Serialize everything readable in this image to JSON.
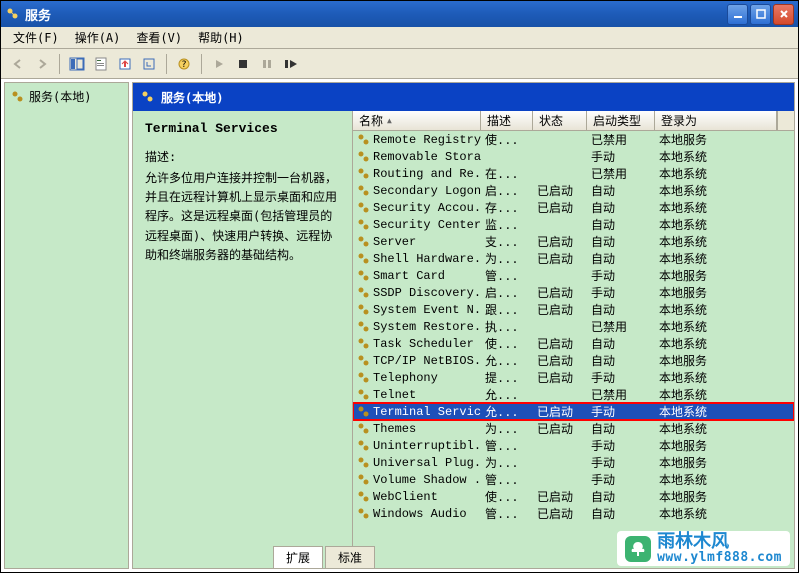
{
  "window": {
    "title": "服务"
  },
  "menu": {
    "file": "文件(F)",
    "action": "操作(A)",
    "view": "查看(V)",
    "help": "帮助(H)"
  },
  "tree": {
    "root": "服务(本地)"
  },
  "panel": {
    "header": "服务(本地)"
  },
  "detail": {
    "service_name": "Terminal Services",
    "desc_label": "描述:",
    "description": "允许多位用户连接并控制一台机器，并且在远程计算机上显示桌面和应用程序。这是远程桌面(包括管理员的远程桌面)、快速用户转换、远程协助和终端服务器的基础结构。"
  },
  "columns": {
    "name": "名称",
    "desc": "描述",
    "status": "状态",
    "startup": "启动类型",
    "logon": "登录为"
  },
  "tabs": {
    "extended": "扩展",
    "standard": "标准"
  },
  "watermark": {
    "brand": "雨林木风",
    "url": "www.ylmf888.com"
  },
  "services": [
    {
      "name": "Remote Registry",
      "desc": "使...",
      "status": "",
      "startup": "已禁用",
      "logon": "本地服务"
    },
    {
      "name": "Removable Storage",
      "desc": "",
      "status": "",
      "startup": "手动",
      "logon": "本地系统"
    },
    {
      "name": "Routing and Re...",
      "desc": "在...",
      "status": "",
      "startup": "已禁用",
      "logon": "本地系统"
    },
    {
      "name": "Secondary Logon",
      "desc": "启...",
      "status": "已启动",
      "startup": "自动",
      "logon": "本地系统"
    },
    {
      "name": "Security Accou...",
      "desc": "存...",
      "status": "已启动",
      "startup": "自动",
      "logon": "本地系统"
    },
    {
      "name": "Security Center",
      "desc": "监...",
      "status": "",
      "startup": "自动",
      "logon": "本地系统"
    },
    {
      "name": "Server",
      "desc": "支...",
      "status": "已启动",
      "startup": "自动",
      "logon": "本地系统"
    },
    {
      "name": "Shell Hardware...",
      "desc": "为...",
      "status": "已启动",
      "startup": "自动",
      "logon": "本地系统"
    },
    {
      "name": "Smart Card",
      "desc": "管...",
      "status": "",
      "startup": "手动",
      "logon": "本地服务"
    },
    {
      "name": "SSDP Discovery...",
      "desc": "启...",
      "status": "已启动",
      "startup": "手动",
      "logon": "本地服务"
    },
    {
      "name": "System Event N...",
      "desc": "跟...",
      "status": "已启动",
      "startup": "自动",
      "logon": "本地系统"
    },
    {
      "name": "System Restore...",
      "desc": "执...",
      "status": "",
      "startup": "已禁用",
      "logon": "本地系统"
    },
    {
      "name": "Task Scheduler",
      "desc": "使...",
      "status": "已启动",
      "startup": "自动",
      "logon": "本地系统"
    },
    {
      "name": "TCP/IP NetBIOS...",
      "desc": "允...",
      "status": "已启动",
      "startup": "自动",
      "logon": "本地服务"
    },
    {
      "name": "Telephony",
      "desc": "提...",
      "status": "已启动",
      "startup": "手动",
      "logon": "本地系统"
    },
    {
      "name": "Telnet",
      "desc": "允...",
      "status": "",
      "startup": "已禁用",
      "logon": "本地系统"
    },
    {
      "name": "Terminal Services",
      "desc": "允...",
      "status": "已启动",
      "startup": "手动",
      "logon": "本地系统",
      "selected": true,
      "highlighted": true
    },
    {
      "name": "Themes",
      "desc": "为...",
      "status": "已启动",
      "startup": "自动",
      "logon": "本地系统"
    },
    {
      "name": "Uninterruptibl...",
      "desc": "管...",
      "status": "",
      "startup": "手动",
      "logon": "本地服务"
    },
    {
      "name": "Universal Plug...",
      "desc": "为...",
      "status": "",
      "startup": "手动",
      "logon": "本地服务"
    },
    {
      "name": "Volume Shadow ...",
      "desc": "管...",
      "status": "",
      "startup": "手动",
      "logon": "本地系统"
    },
    {
      "name": "WebClient",
      "desc": "使...",
      "status": "已启动",
      "startup": "自动",
      "logon": "本地服务"
    },
    {
      "name": "Windows Audio",
      "desc": "管...",
      "status": "已启动",
      "startup": "自动",
      "logon": "本地系统"
    }
  ]
}
